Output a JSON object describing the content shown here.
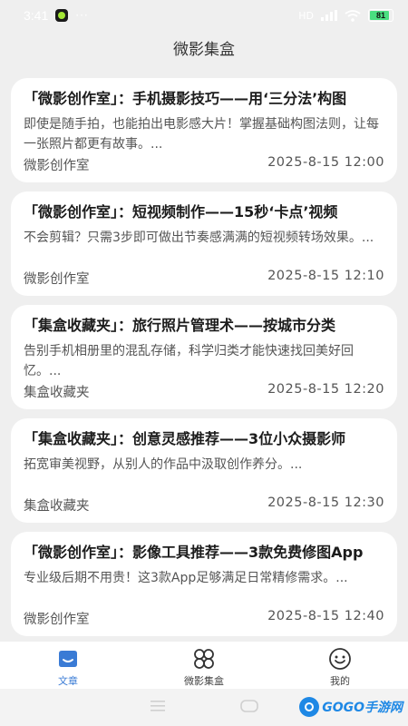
{
  "status_bar": {
    "time": "3:41",
    "dots": "···",
    "network": "HD",
    "battery": "81"
  },
  "header": {
    "title": "微影集盒"
  },
  "articles": [
    {
      "title": "「微影创作室」：手机摄影技巧——用‘三分法’构图",
      "summary": "即使是随手拍，也能拍出电影感大片！掌握基础构图法则，让每一张照片都更有故事。...",
      "source": "微影创作室",
      "date": "2025-8-15 12:00"
    },
    {
      "title": "「微影创作室」：短视频制作——15秒‘卡点’视频",
      "summary": "不会剪辑？只需3步即可做出节奏感满满的短视频转场效果。...",
      "source": "微影创作室",
      "date": "2025-8-15 12:10"
    },
    {
      "title": "「集盒收藏夹」：旅行照片管理术——按城市分类",
      "summary": "告别手机相册里的混乱存储，科学归类才能快速找回美好回忆。...",
      "source": "集盒收藏夹",
      "date": "2025-8-15 12:20"
    },
    {
      "title": "「集盒收藏夹」：创意灵感推荐——3位小众摄影师",
      "summary": "拓宽审美视野，从别人的作品中汲取创作养分。...",
      "source": "集盒收藏夹",
      "date": "2025-8-15 12:30"
    },
    {
      "title": "「微影创作室」：影像工具推荐——3款免费修图App",
      "summary": "专业级后期不用贵！这3款App足够满足日常精修需求。...",
      "source": "微影创作室",
      "date": "2025-8-15 12:40"
    }
  ],
  "tabs": [
    {
      "label": "文章",
      "icon": "article-icon",
      "active": true
    },
    {
      "label": "微影集盒",
      "icon": "grid-icon",
      "active": false
    },
    {
      "label": "我的",
      "icon": "smiley-icon",
      "active": false
    }
  ],
  "watermark": {
    "text": "GOGO手游网"
  },
  "colors": {
    "accent": "#3a7bd5",
    "card": "#ffffff",
    "background": "#efefef"
  }
}
